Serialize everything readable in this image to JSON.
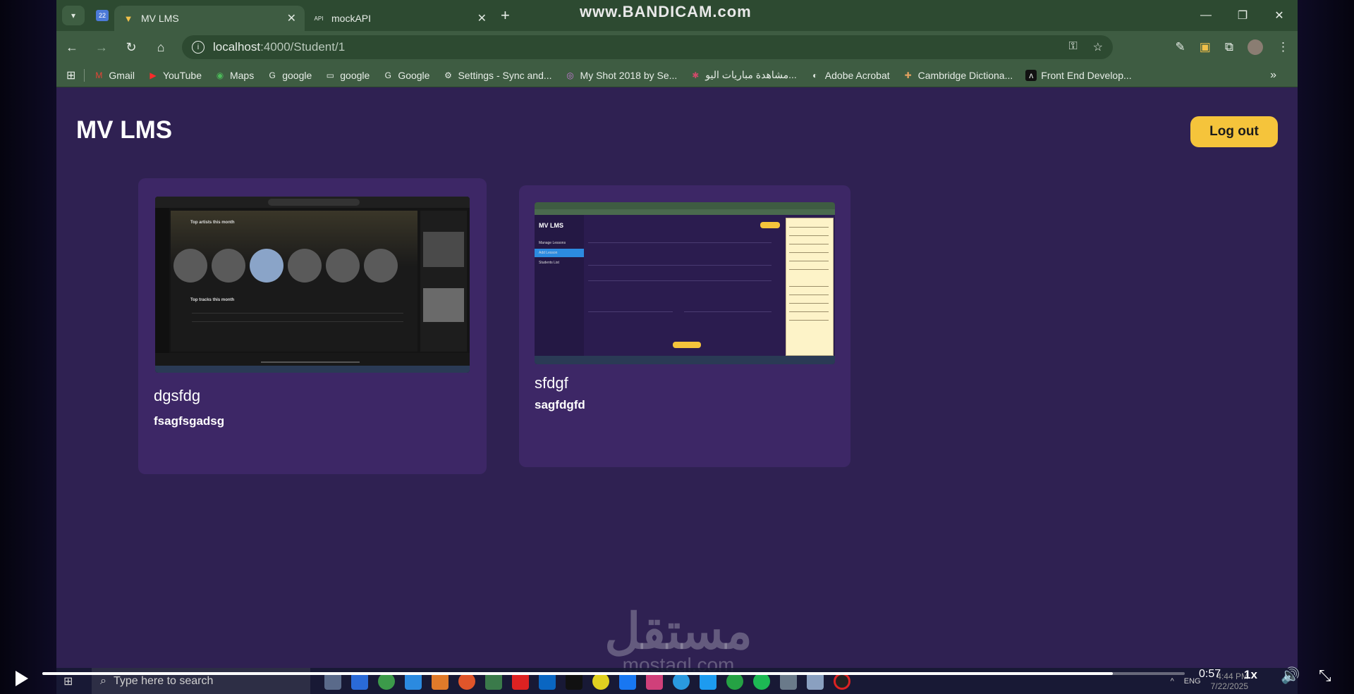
{
  "browser": {
    "tabs": [
      {
        "title": "MV LMS",
        "active": true,
        "icon": "vite-icon"
      },
      {
        "title": "mockAPI",
        "active": false,
        "icon": "api-icon"
      }
    ],
    "pinned_tab_label": "22",
    "recorder_watermark": "www.BANDICAM.com",
    "address": {
      "host": "localhost",
      "path": ":4000/Student/1"
    },
    "bookmarks": [
      {
        "label": "Gmail",
        "icon": "gmail-icon"
      },
      {
        "label": "YouTube",
        "icon": "youtube-icon"
      },
      {
        "label": "Maps",
        "icon": "maps-icon"
      },
      {
        "label": "google",
        "icon": "google-icon"
      },
      {
        "label": "google",
        "icon": "folder-icon"
      },
      {
        "label": "Google",
        "icon": "google-icon"
      },
      {
        "label": "Settings - Sync and...",
        "icon": "gear-icon"
      },
      {
        "label": "My Shot 2018 by Se...",
        "icon": "dribbble-icon"
      },
      {
        "label": "مشاهدة مباريات اليو...",
        "icon": "site-icon"
      },
      {
        "label": "Adobe Acrobat",
        "icon": "acrobat-icon"
      },
      {
        "label": "Cambridge Dictiona...",
        "icon": "cambridge-icon"
      },
      {
        "label": "Front End Develop...",
        "icon": "frontend-icon"
      }
    ]
  },
  "app": {
    "brand": "MV LMS",
    "logout_label": "Log out",
    "lessons": [
      {
        "title": "dgsfdg",
        "description": "fsagfsgadsg"
      },
      {
        "title": "sfdgf",
        "description": "sagfdgfd"
      }
    ]
  },
  "thumb1": {
    "label": "Top artists this month",
    "label2": "Top tracks this month"
  },
  "thumb2": {
    "logo": "MV LMS",
    "items": [
      "Manage Lessons",
      "Add Lesson",
      "Students List"
    ]
  },
  "watermark": {
    "main": "مستقل",
    "sub": "mostaql.com"
  },
  "taskbar": {
    "search_placeholder": "Type here to search",
    "lang": "ENG",
    "time": "4:44 PM",
    "date": "7/22/2025"
  },
  "player": {
    "elapsed": "0:57",
    "progress": 0.937,
    "speed": "1x"
  }
}
